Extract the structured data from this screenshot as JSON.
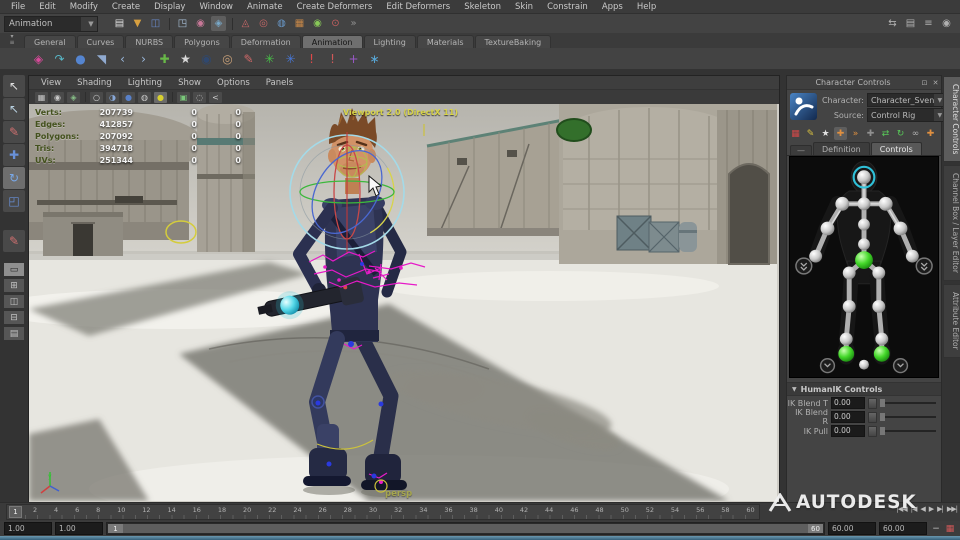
{
  "menubar": {
    "items": [
      "File",
      "Edit",
      "Modify",
      "Create",
      "Display",
      "Window",
      "Animate",
      "Create Deformers",
      "Edit Deformers",
      "Skeleton",
      "Skin",
      "Constrain",
      "Apps",
      "Help"
    ]
  },
  "statusline": {
    "menuset": "Animation",
    "icons": [
      {
        "name": "new-scene-icon",
        "glyph": "▤",
        "color": "#e0e0e0"
      },
      {
        "name": "open-scene-icon",
        "glyph": "▼",
        "color": "#d8a040"
      },
      {
        "name": "save-scene-icon",
        "glyph": "◫",
        "color": "#6888c8"
      },
      {
        "sep": true
      },
      {
        "name": "select-hierarchy-icon",
        "glyph": "◳",
        "color": "#a8c0d8"
      },
      {
        "name": "select-object-icon",
        "glyph": "◉",
        "color": "#c87898"
      },
      {
        "name": "select-component-icon",
        "glyph": "◈",
        "color": "#78a8c8",
        "active": true
      },
      {
        "sep": true
      },
      {
        "name": "snap-grid-icon",
        "glyph": "◬",
        "color": "#c86868"
      },
      {
        "name": "snap-curve-icon",
        "glyph": "◎",
        "color": "#c86868"
      },
      {
        "name": "snap-point-icon",
        "glyph": "◍",
        "color": "#6898c8"
      },
      {
        "name": "snap-plane-icon",
        "glyph": "▦",
        "color": "#c88848"
      },
      {
        "name": "snap-surface-icon",
        "glyph": "◉",
        "color": "#88c858"
      },
      {
        "name": "make-live-icon",
        "glyph": "⊙",
        "color": "#c86060"
      },
      {
        "name": "more-icon",
        "glyph": "»",
        "color": "#909090"
      }
    ],
    "right_icons": [
      {
        "name": "workspace-icon",
        "glyph": "⇆"
      },
      {
        "name": "editor-layout-icon",
        "glyph": "▤"
      },
      {
        "name": "menu-lines-icon",
        "glyph": "≡"
      },
      {
        "name": "render-globe-icon",
        "glyph": "◉"
      }
    ]
  },
  "shelf": {
    "tabs": [
      {
        "label": "General"
      },
      {
        "label": "Curves"
      },
      {
        "label": "NURBS"
      },
      {
        "label": "Polygons"
      },
      {
        "label": "Deformation"
      },
      {
        "label": "Animation",
        "active": true
      },
      {
        "label": "Lighting"
      },
      {
        "label": "Materials"
      },
      {
        "label": "TextureBaking"
      }
    ],
    "icons": [
      {
        "name": "set-key-icon",
        "glyph": "◈",
        "color": "#d84a9a"
      },
      {
        "name": "motion-path-icon",
        "glyph": "↷",
        "color": "#58b8c8"
      },
      {
        "name": "joint-tool-icon",
        "glyph": "●",
        "color": "#5585d0"
      },
      {
        "name": "orient-icon",
        "glyph": "◥",
        "color": "#90aad0"
      },
      {
        "name": "ik-chain-icon",
        "glyph": "‹",
        "color": "#9ab8dc"
      },
      {
        "name": "ik-spline-icon",
        "glyph": "›",
        "color": "#9ab8dc"
      },
      {
        "name": "ik-handle-icon",
        "glyph": "✚",
        "color": "#68b848"
      },
      {
        "name": "skeleton-icon",
        "glyph": "★",
        "color": "#d8d8d8"
      },
      {
        "name": "character-pair-icon",
        "glyph": "◉",
        "color": "#30486e"
      },
      {
        "name": "character-icon",
        "glyph": "◎",
        "color": "#c8a078"
      },
      {
        "name": "paint-weights-icon",
        "glyph": "✎",
        "color": "#d06868"
      },
      {
        "name": "locator-green-icon",
        "glyph": "✳",
        "color": "#48c048"
      },
      {
        "name": "locator-blue-icon",
        "glyph": "✳",
        "color": "#4878d8"
      },
      {
        "name": "breakdown-red-icon",
        "glyph": "!",
        "color": "#e04848"
      },
      {
        "name": "breakdown-icon",
        "glyph": "!",
        "color": "#d05858"
      },
      {
        "name": "axis-icon",
        "glyph": "+",
        "color": "#9a58c8"
      },
      {
        "name": "cluster-icon",
        "glyph": "∗",
        "color": "#58a8d8"
      }
    ]
  },
  "toolbox": {
    "tools": [
      {
        "name": "select-tool",
        "glyph": "↖",
        "color": "#e0e0e0"
      },
      {
        "name": "lasso-tool",
        "glyph": "↖",
        "color": "#b8d0e0"
      },
      {
        "name": "paint-select-tool",
        "glyph": "✎",
        "color": "#d07070"
      },
      {
        "name": "move-tool",
        "glyph": "✚",
        "color": "#6890d8"
      },
      {
        "name": "rotate-tool",
        "glyph": "↻",
        "color": "#79a8e8",
        "active": true
      },
      {
        "name": "scale-tool",
        "glyph": "◰",
        "color": "#6890d8"
      }
    ],
    "extra": [
      {
        "name": "last-tool",
        "glyph": "✎",
        "color": "#d07070"
      }
    ],
    "layouts": [
      {
        "name": "layout-single",
        "glyph": "▭",
        "active": true
      },
      {
        "name": "layout-four",
        "glyph": "⊞"
      },
      {
        "name": "layout-two-side",
        "glyph": "◫"
      },
      {
        "name": "layout-two-stack",
        "glyph": "⊟"
      },
      {
        "name": "layout-outliner",
        "glyph": "▤"
      }
    ]
  },
  "viewport": {
    "menus": [
      "View",
      "Shading",
      "Lighting",
      "Show",
      "Options",
      "Panels"
    ],
    "icons": [
      {
        "name": "camera-attrs-icon",
        "glyph": "▦",
        "color": "#c8c8c8"
      },
      {
        "name": "bookmark-icon",
        "glyph": "◉",
        "color": "#c8c8c8"
      },
      {
        "name": "image-plane-icon",
        "glyph": "◈",
        "color": "#88c088"
      },
      {
        "sep": true
      },
      {
        "name": "wireframe-icon",
        "glyph": "○",
        "color": "#cccccc"
      },
      {
        "name": "shaded-icon",
        "glyph": "◑",
        "color": "#88a8d8"
      },
      {
        "name": "textured-icon",
        "glyph": "●",
        "color": "#5880c8"
      },
      {
        "name": "all-lights-icon",
        "glyph": "◍",
        "color": "#cccccc"
      },
      {
        "name": "default-light-icon",
        "glyph": "●",
        "color": "#d8d030",
        "active": true
      },
      {
        "sep": true
      },
      {
        "name": "isolate-icon",
        "glyph": "▣",
        "color": "#7ac87a"
      },
      {
        "name": "xray-icon",
        "glyph": "◌",
        "color": "#cccccc"
      },
      {
        "name": "share-icon",
        "glyph": "<",
        "color": "#cccccc"
      }
    ],
    "renderer_label": "Viewport 2.0 (DirectX 11)",
    "camera_label": "persp",
    "hud": {
      "rows": [
        {
          "label": "Verts:",
          "total": "207739",
          "sel": "0",
          "comp": "0"
        },
        {
          "label": "Edges:",
          "total": "412857",
          "sel": "0",
          "comp": "0"
        },
        {
          "label": "Polygons:",
          "total": "207092",
          "sel": "0",
          "comp": "0"
        },
        {
          "label": "Tris:",
          "total": "394718",
          "sel": "0",
          "comp": "0"
        },
        {
          "label": "UVs:",
          "total": "251344",
          "sel": "0",
          "comp": "0"
        }
      ]
    }
  },
  "character_panel": {
    "title": "Character Controls",
    "header_icons": [
      {
        "name": "float-icon",
        "glyph": "⊡"
      },
      {
        "name": "close-icon",
        "glyph": "✕"
      }
    ],
    "character_label": "Character:",
    "character_value": "Character_Sven",
    "source_label": "Source:",
    "source_value": "Control Rig",
    "icons": [
      {
        "name": "match-grid-icon",
        "glyph": "▦",
        "color": "#d04848"
      },
      {
        "name": "edit-definition-icon",
        "glyph": "✎",
        "color": "#d8c040"
      },
      {
        "name": "skeleton-white-icon",
        "glyph": "★",
        "color": "#e0e0e0"
      },
      {
        "name": "full-body-icon",
        "glyph": "✚",
        "color": "#e09040",
        "active": true
      },
      {
        "name": "body-part-icon",
        "glyph": "»",
        "color": "#e09040"
      },
      {
        "name": "selection-icon",
        "glyph": "✚",
        "color": "#909090"
      },
      {
        "name": "mirror-icon",
        "glyph": "⇄",
        "color": "#58c858"
      },
      {
        "name": "cycle-icon",
        "glyph": "↻",
        "color": "#58c858"
      },
      {
        "name": "pin-icon",
        "glyph": "∞",
        "color": "#b0b0b0"
      },
      {
        "name": "stance-pose-icon",
        "glyph": "✚",
        "color": "#e09040"
      }
    ],
    "tab_stub": "—",
    "tabs": [
      {
        "label": "Definition"
      },
      {
        "label": "Controls",
        "active": true
      }
    ],
    "humanik": {
      "title": "HumanIK Controls",
      "rows": [
        {
          "label": "IK Blend T",
          "value": "0.00"
        },
        {
          "label": "IK Blend R",
          "value": "0.00"
        },
        {
          "label": "IK Pull",
          "value": "0.00"
        }
      ]
    }
  },
  "side_tabs": [
    {
      "label": "Character Controls",
      "active": true
    },
    {
      "label": "Channel Box / Layer Editor"
    },
    {
      "label": "Attribute Editor"
    }
  ],
  "timeline": {
    "current_frame": "1",
    "tick_labels": [
      "2",
      "4",
      "6",
      "8",
      "10",
      "12",
      "14",
      "16",
      "18",
      "20",
      "22",
      "24",
      "26",
      "28",
      "30",
      "32",
      "34",
      "36",
      "38",
      "40",
      "42",
      "44",
      "46",
      "48",
      "50",
      "52",
      "54",
      "56",
      "58",
      "60"
    ],
    "playback": [
      {
        "name": "go-to-start-button",
        "glyph": "|◀◀"
      },
      {
        "name": "step-back-button",
        "glyph": "|◀"
      },
      {
        "name": "play-backwards-button",
        "glyph": "◀"
      },
      {
        "name": "play-forwards-button",
        "glyph": "▶"
      },
      {
        "name": "step-forward-button",
        "glyph": "▶|"
      },
      {
        "name": "go-to-end-button",
        "glyph": "▶▶|"
      }
    ]
  },
  "rangebar": {
    "playback_start": "1.00",
    "anim_start": "1.00",
    "range_start": "1",
    "range_end": "60",
    "anim_end": "60.00",
    "playback_end": "60.00",
    "icons": [
      {
        "name": "auto-key-icon",
        "glyph": "−",
        "color": "#c0c0c0"
      },
      {
        "name": "anim-prefs-icon",
        "glyph": "▦",
        "color": "#d05858"
      }
    ]
  },
  "brand": {
    "name": "AUTODESK"
  }
}
